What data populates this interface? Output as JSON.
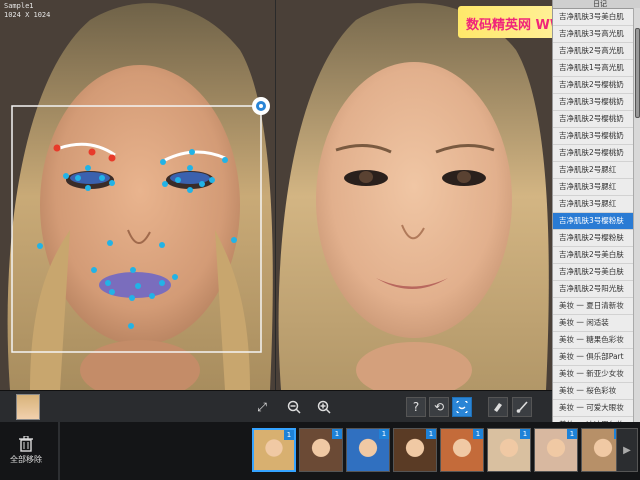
{
  "watermark": {
    "text": "数码精英网 WWW.SMCE"
  },
  "image_info": {
    "title": "Sample1",
    "resolution": "1024 X 1024"
  },
  "toolbar": {
    "help_label": "?",
    "fit_icon": "fit-screen-icon",
    "zoom_out_icon": "zoom-out-icon",
    "zoom_in_icon": "zoom-in-icon",
    "refresh_icon": "refresh-icon",
    "face_icon": "face-detect-icon",
    "eraser_icon": "eraser-icon",
    "brush_icon": "brush-icon"
  },
  "side_panel": {
    "header": "日记",
    "items": [
      "吉净肌肤3号美白肌",
      "吉净肌肤3号高光肌",
      "吉净肌肤2号高光肌",
      "吉净肌肤1号高光肌",
      "吉净肌肤2号樱桃奶",
      "吉净肌肤3号樱桃奶",
      "吉净肌肤2号樱桃奶",
      "吉净肌肤3号樱桃奶",
      "吉净肌肤2号樱桃奶",
      "吉净肌肤2号腮红",
      "吉净肌肤3号腮红",
      "吉净肌肤3号腮红",
      "吉净肌肤3号樱粉肤",
      "吉净肌肤2号樱粉肤",
      "吉净肌肤2号美白肤",
      "吉净肌肤2号美白肤",
      "吉净肌肤2号阳光肤",
      "美妆 一 夏日清新妆",
      "美妆 一 闲适装",
      "美妆 一 糖果色彩妆",
      "美妆 一 俱乐部Part",
      "美妆 一 新亚少女妆",
      "美妆 一 桜色彩妆",
      "美妆 一 可爱大眼妆",
      "美妆 一 冰冰巴尔妆"
    ],
    "selected_index": 12
  },
  "bottom": {
    "remove_all_label": "全部移除",
    "remove_icon": "trash-icon",
    "thumbnails": [
      {
        "name": "thumb-1",
        "badge": "1",
        "active": true,
        "bg": "#d8b070"
      },
      {
        "name": "thumb-2",
        "badge": "1",
        "active": false,
        "bg": "#6b4a35"
      },
      {
        "name": "thumb-3",
        "badge": "1",
        "active": false,
        "bg": "#3070c0"
      },
      {
        "name": "thumb-4",
        "badge": "1",
        "active": false,
        "bg": "#5a3b25"
      },
      {
        "name": "thumb-5",
        "badge": "1",
        "active": false,
        "bg": "#c46b3a"
      },
      {
        "name": "thumb-6",
        "badge": "1",
        "active": false,
        "bg": "#d9c0a0"
      },
      {
        "name": "thumb-7",
        "badge": "1",
        "active": false,
        "bg": "#d8b8a0"
      },
      {
        "name": "thumb-8",
        "badge": "1",
        "active": false,
        "bg": "#b79068"
      }
    ]
  },
  "colors": {
    "accent": "#2a85d6",
    "landmark": "#22b3e6",
    "brow_marker": "#e83a2a",
    "watermark_text": "#f0247a"
  }
}
